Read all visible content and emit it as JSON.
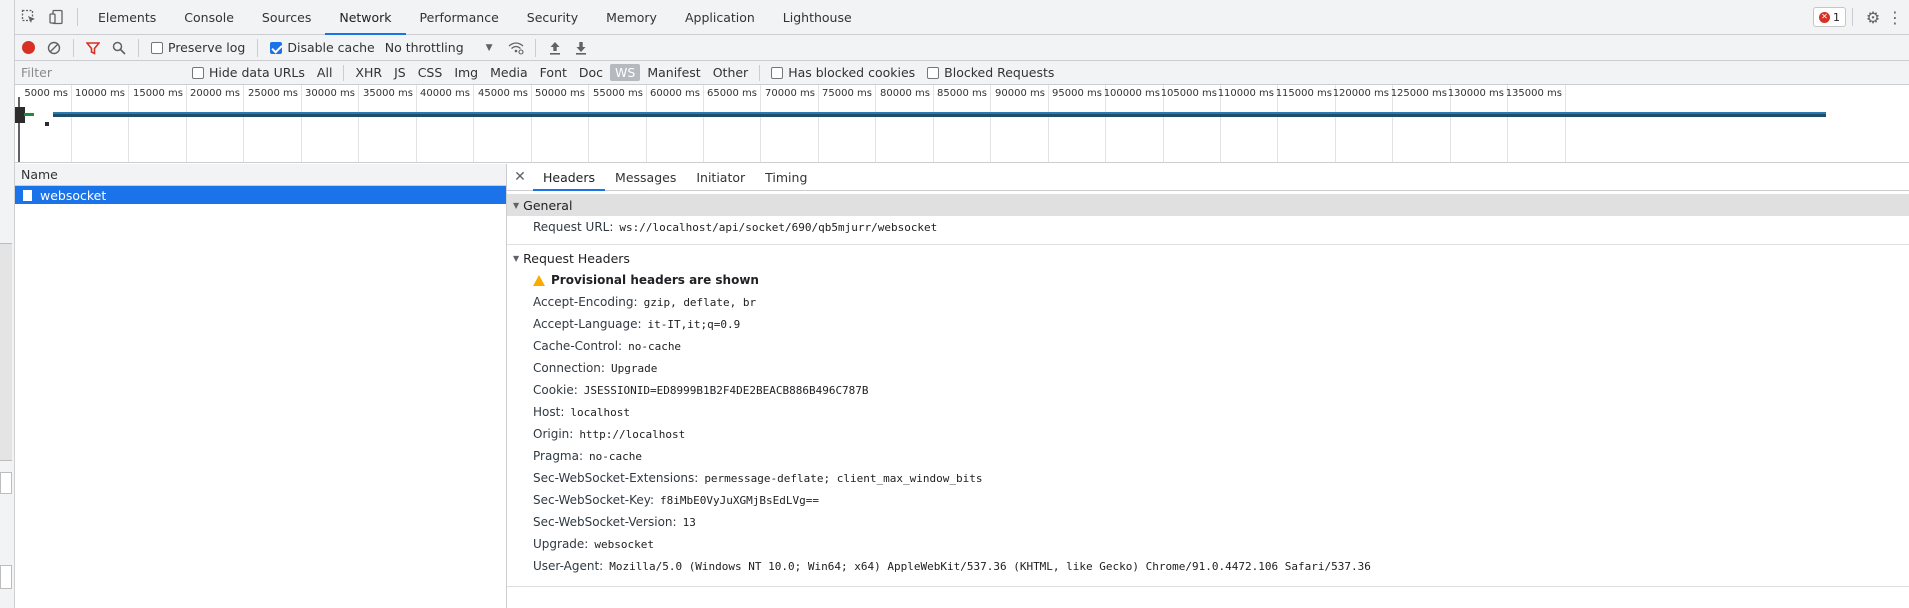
{
  "devtools": {
    "tabs": [
      "Elements",
      "Console",
      "Sources",
      "Network",
      "Performance",
      "Security",
      "Memory",
      "Application",
      "Lighthouse"
    ],
    "active_tab": "Network",
    "error_count": "1"
  },
  "toolbar": {
    "preserve_log": "Preserve log",
    "disable_cache": "Disable cache",
    "throttling": "No throttling"
  },
  "filter": {
    "placeholder": "Filter",
    "hide_data_urls": "Hide data URLs",
    "types": [
      "All",
      "XHR",
      "JS",
      "CSS",
      "Img",
      "Media",
      "Font",
      "Doc",
      "WS",
      "Manifest",
      "Other"
    ],
    "active_type": "WS",
    "has_blocked_cookies": "Has blocked cookies",
    "blocked_requests": "Blocked Requests"
  },
  "overview": {
    "ticks": [
      "5000 ms",
      "10000 ms",
      "15000 ms",
      "20000 ms",
      "25000 ms",
      "30000 ms",
      "35000 ms",
      "40000 ms",
      "45000 ms",
      "50000 ms",
      "55000 ms",
      "60000 ms",
      "65000 ms",
      "70000 ms",
      "75000 ms",
      "80000 ms",
      "85000 ms",
      "90000 ms",
      "95000 ms",
      "100000 ms",
      "105000 ms",
      "110000 ms",
      "115000 ms",
      "120000 ms",
      "125000 ms",
      "130000 ms",
      "135000 ms"
    ]
  },
  "request_list": {
    "column_name": "Name",
    "rows": [
      {
        "name": "websocket"
      }
    ]
  },
  "details": {
    "tabs": [
      "Headers",
      "Messages",
      "Initiator",
      "Timing"
    ],
    "active_tab": "Headers",
    "general": {
      "title": "General",
      "request_url_label": "Request URL:",
      "request_url": "ws://localhost/api/socket/690/qb5mjurr/websocket"
    },
    "request_headers": {
      "title": "Request Headers",
      "warning": "Provisional headers are shown",
      "headers": [
        {
          "name": "Accept-Encoding:",
          "value": "gzip, deflate, br"
        },
        {
          "name": "Accept-Language:",
          "value": "it-IT,it;q=0.9"
        },
        {
          "name": "Cache-Control:",
          "value": "no-cache"
        },
        {
          "name": "Connection:",
          "value": "Upgrade"
        },
        {
          "name": "Cookie:",
          "value": "JSESSIONID=ED8999B1B2F4DE2BEACB886B496C787B"
        },
        {
          "name": "Host:",
          "value": "localhost"
        },
        {
          "name": "Origin:",
          "value": "http://localhost"
        },
        {
          "name": "Pragma:",
          "value": "no-cache"
        },
        {
          "name": "Sec-WebSocket-Extensions:",
          "value": "permessage-deflate; client_max_window_bits"
        },
        {
          "name": "Sec-WebSocket-Key:",
          "value": "f8iMbE0VyJuXGMjBsEdLVg=="
        },
        {
          "name": "Sec-WebSocket-Version:",
          "value": "13"
        },
        {
          "name": "Upgrade:",
          "value": "websocket"
        },
        {
          "name": "User-Agent:",
          "value": "Mozilla/5.0 (Windows NT 10.0; Win64; x64) AppleWebKit/537.36 (KHTML, like Gecko) Chrome/91.0.4472.106 Safari/537.36"
        }
      ]
    }
  }
}
